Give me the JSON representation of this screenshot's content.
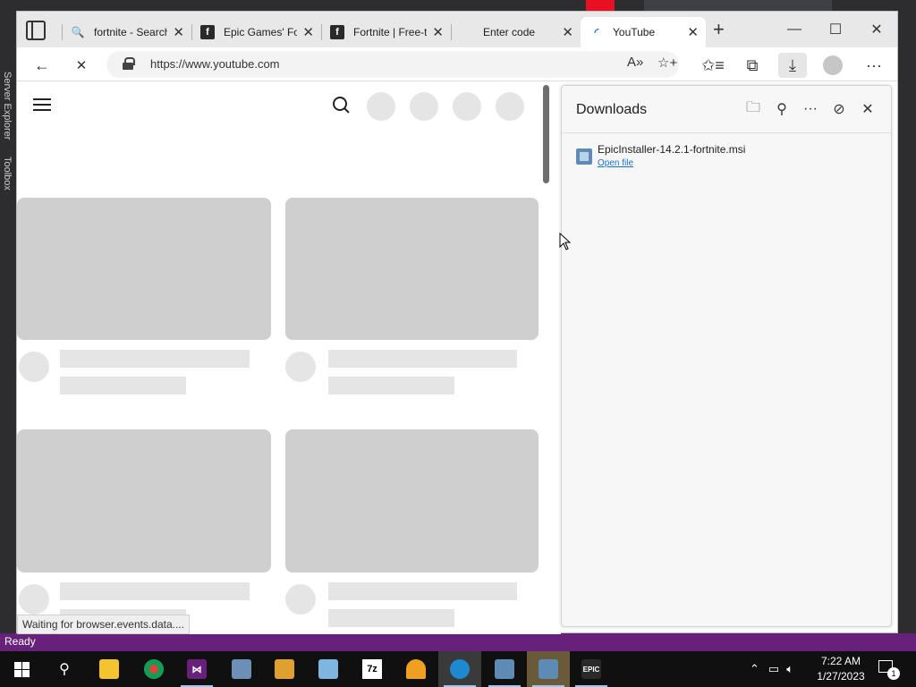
{
  "background": {
    "left_labels": [
      "Server Explorer",
      "Toolbox"
    ],
    "status": "Ready"
  },
  "browser": {
    "tabs": [
      {
        "title": "fortnite - Search",
        "icon": "bing-search-icon",
        "active": false
      },
      {
        "title": "Epic Games' Fortnite",
        "icon": "epic-games-icon",
        "active": false
      },
      {
        "title": "Fortnite | Free-to-Play",
        "icon": "epic-games-icon",
        "active": false
      },
      {
        "title": "Enter code",
        "icon": "microsoft-logo-icon",
        "active": false
      },
      {
        "title": "YouTube",
        "icon": "loading-icon",
        "active": true
      }
    ],
    "new_tab_symbol": "+",
    "window_controls": {
      "minimize": "—",
      "maximize": "☐",
      "close": "✕"
    },
    "address": {
      "url": "https://www.youtube.com"
    },
    "nav": {
      "back": "←",
      "stop": "✕"
    },
    "toolbar": {
      "read_aloud": "A»",
      "add_favorite": "☆+",
      "favorites": "✩≡",
      "collections": "⧉",
      "downloads": "⤓",
      "more": "···"
    }
  },
  "page": {
    "status_bubble": "Waiting for browser.events.data...."
  },
  "downloads": {
    "title": "Downloads",
    "items": [
      {
        "filename": "EpicInstaller-14.2.1-fortnite.msi",
        "action": "Open file"
      }
    ]
  },
  "taskbar": {
    "clock_time": "7:22 AM",
    "clock_date": "1/27/2023",
    "notification_count": "1",
    "apps": [
      {
        "name": "file-explorer-icon",
        "color": "#f4c430"
      },
      {
        "name": "chrome-icon",
        "color": "#db4437"
      },
      {
        "name": "visual-studio-icon",
        "color": "#68217a"
      },
      {
        "name": "control-panel-icon",
        "color": "#6b8fb5"
      },
      {
        "name": "toolbox-app-icon",
        "color": "#e0a030"
      },
      {
        "name": "notepad-icon",
        "color": "#7fb6e0"
      },
      {
        "name": "7zip-icon",
        "color": "#ffffff"
      },
      {
        "name": "pizza-app-icon",
        "color": "#f0a020"
      },
      {
        "name": "edge-icon",
        "color": "#1e88d0"
      },
      {
        "name": "installer-icon",
        "color": "#5e8bb5"
      },
      {
        "name": "installer-icon-2",
        "color": "#5e8bb5"
      },
      {
        "name": "epic-games-launcher-icon",
        "color": "#2a2a2a"
      }
    ],
    "apps_labels": {
      "sevenzip": "7z",
      "epic": "EPIC"
    }
  },
  "colors": {
    "vs_status": "#68217a",
    "link": "#1a6fd1",
    "skeleton": "#cfcfcf"
  }
}
